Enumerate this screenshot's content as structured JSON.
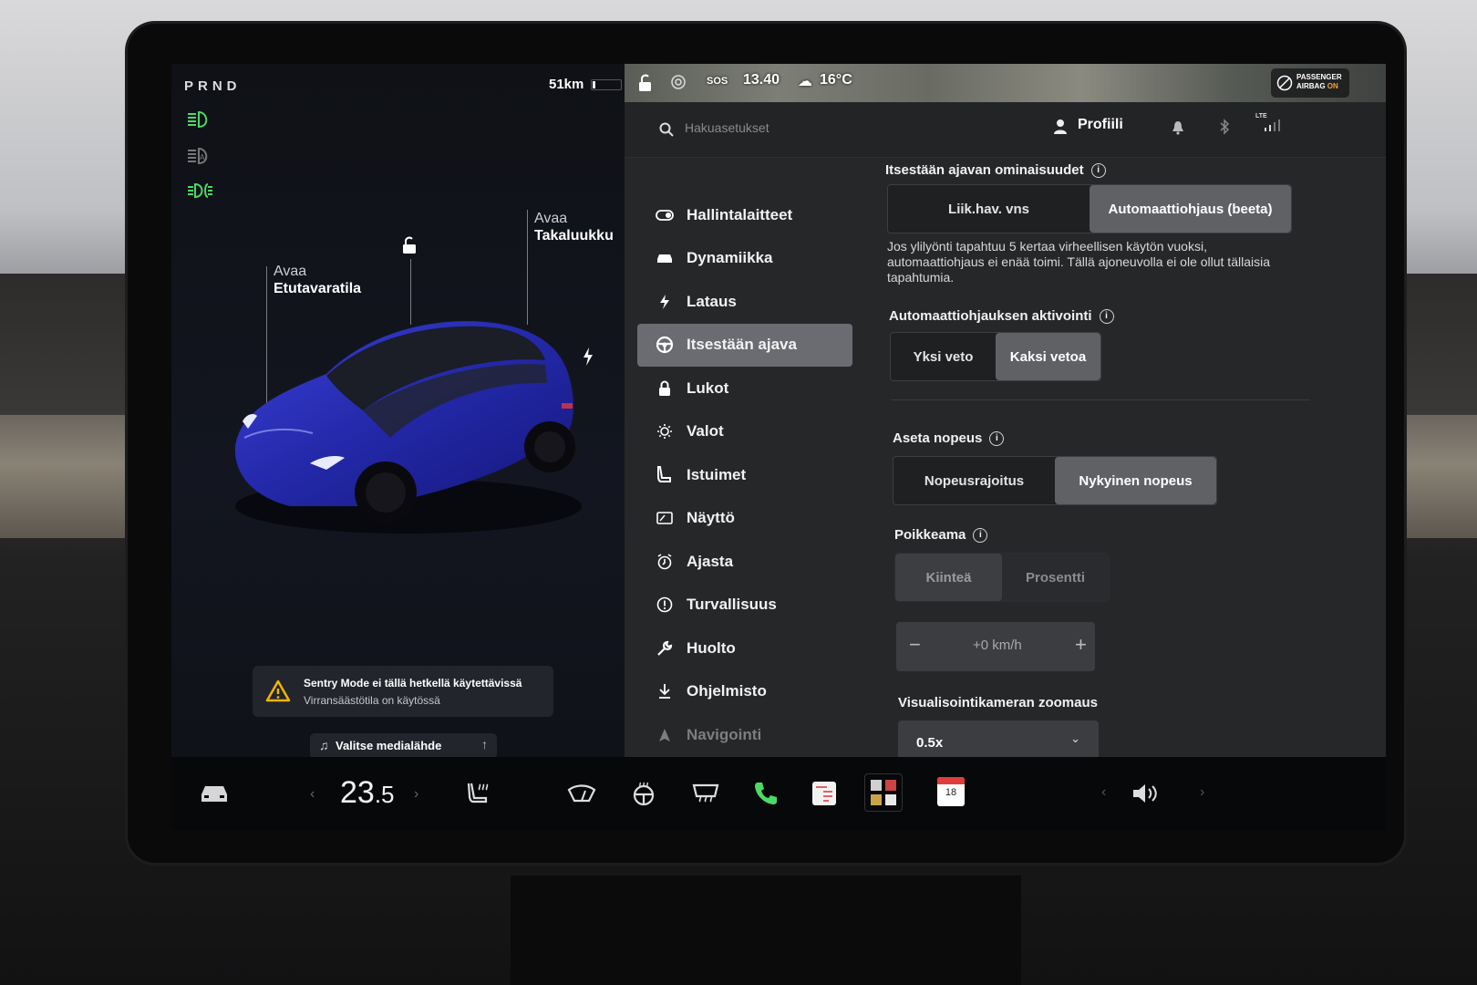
{
  "gear": "PRND",
  "range": "51km",
  "callouts": {
    "frunk": {
      "line1": "Avaa",
      "line2": "Etutavaratila"
    },
    "trunk": {
      "line1": "Avaa",
      "line2": "Takaluukku"
    }
  },
  "sentry": {
    "title": "Sentry Mode ei tällä hetkellä käytettävissä",
    "subtitle": "Virransäästötila on käytössä"
  },
  "media": {
    "label": "Valitse medialähde"
  },
  "status": {
    "sos": "SOS",
    "time": "13.40",
    "temp": "16°C",
    "network": "LTE"
  },
  "airbag": {
    "line1": "PASSENGER",
    "line2": "AIRBAG",
    "state": "ON"
  },
  "search": {
    "placeholder": "Hakuasetukset"
  },
  "profile": {
    "label": "Profiili"
  },
  "nav": [
    {
      "label": "Hallintalaitteet",
      "icon": "toggle-icon"
    },
    {
      "label": "Dynamiikka",
      "icon": "car-icon"
    },
    {
      "label": "Lataus",
      "icon": "bolt-icon"
    },
    {
      "label": "Itsestään ajava",
      "icon": "steering-wheel-icon",
      "selected": true
    },
    {
      "label": "Lukot",
      "icon": "lock-icon"
    },
    {
      "label": "Valot",
      "icon": "light-icon"
    },
    {
      "label": "Istuimet",
      "icon": "seat-icon"
    },
    {
      "label": "Näyttö",
      "icon": "display-icon"
    },
    {
      "label": "Ajasta",
      "icon": "alarm-clock-icon"
    },
    {
      "label": "Turvallisuus",
      "icon": "safety-icon"
    },
    {
      "label": "Huolto",
      "icon": "wrench-icon"
    },
    {
      "label": "Ohjelmisto",
      "icon": "download-icon"
    },
    {
      "label": "Navigointi",
      "icon": "navigation-icon"
    }
  ],
  "settings": {
    "features": {
      "title": "Itsestään ajavan ominaisuudet",
      "options": [
        "Liik.hav. vns",
        "Automaattiohjaus (beeta)"
      ],
      "selected": 1,
      "note": "Jos ylilyönti tapahtuu 5 kertaa virheellisen käytön vuoksi, automaattiohjaus ei enää toimi. Tällä ajoneuvolla ei ole ollut tällaisia tapahtumia."
    },
    "activation": {
      "title": "Automaattiohjauksen aktivointi",
      "options": [
        "Yksi veto",
        "Kaksi vetoa"
      ],
      "selected": 1
    },
    "speed": {
      "title": "Aseta nopeus",
      "options": [
        "Nopeusrajoitus",
        "Nykyinen nopeus"
      ],
      "selected": 1
    },
    "offset": {
      "title": "Poikkeama",
      "options": [
        "Kiinteä",
        "Prosentti"
      ],
      "selected": 0,
      "value": "+0 km/h",
      "minus": "−",
      "plus": "+"
    },
    "zoom": {
      "title": "Visualisointikameran zoomaus",
      "value": "0.5x"
    }
  },
  "bottom": {
    "temp_int": "23",
    "temp_dec": ".5",
    "calendar_day": "18"
  },
  "colors": {
    "accent_green": "#4cd964",
    "panel": "#262729",
    "selected": "#6a6c71",
    "car_blue": "#2a2fb8"
  }
}
